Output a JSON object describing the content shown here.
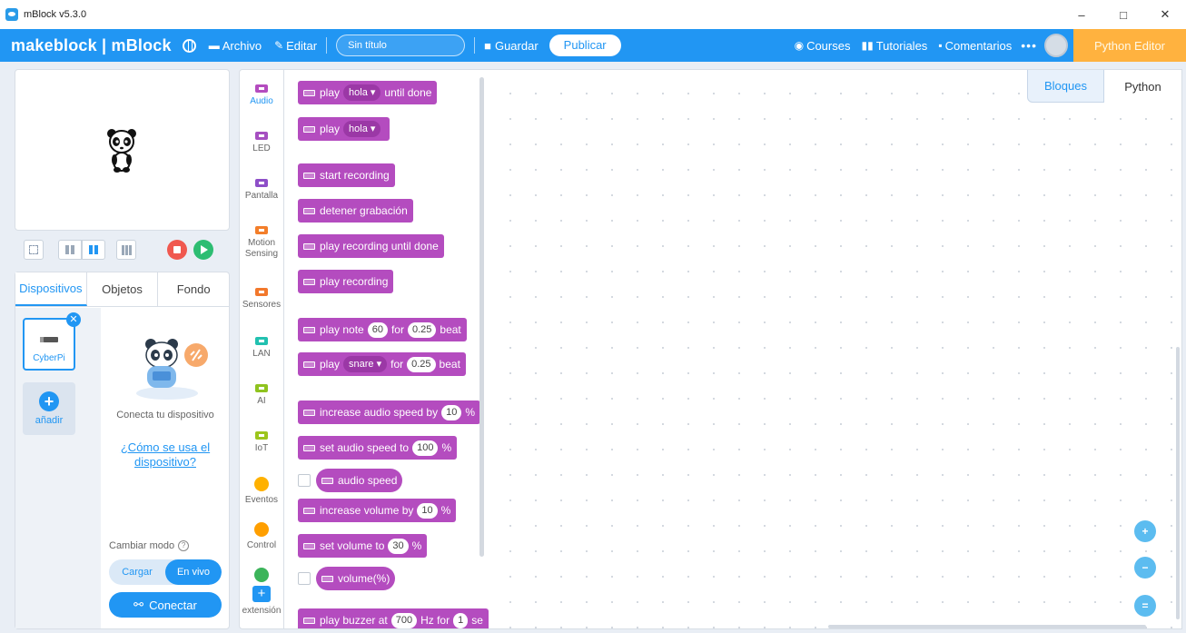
{
  "window": {
    "title": "mBlock v5.3.0",
    "minimize": "–",
    "maximize": "□",
    "close": "✕"
  },
  "menubar": {
    "brand": "makeblock | mBlock",
    "archivo": "Archivo",
    "editar": "Editar",
    "project_name": "Sin título",
    "guardar": "Guardar",
    "publicar": "Publicar",
    "courses": "Courses",
    "tutoriales": "Tutoriales",
    "comentarios": "Comentarios",
    "more": "•••",
    "python_editor": "Python Editor"
  },
  "device_panel": {
    "tabs": [
      "Dispositivos",
      "Objetos",
      "Fondo"
    ],
    "active_tab": "Dispositivos",
    "device_name": "CyberPi",
    "add_label": "añadir",
    "connect_prompt": "Conecta tu dispositivo",
    "how_link": "¿Cómo se usa el dispositivo?",
    "mode_label": "Cambiar modo",
    "mode_help": "?",
    "mode_options": [
      "Cargar",
      "En vivo"
    ],
    "mode_selected": "En vivo",
    "connect_button": "Conectar"
  },
  "categories": [
    {
      "label": "Audio",
      "color": "#b44cbf",
      "shape": "chip"
    },
    {
      "label": "LED",
      "color": "#a64fc1",
      "shape": "chip"
    },
    {
      "label": "Pantalla",
      "color": "#8e4fc8",
      "shape": "chip"
    },
    {
      "label": "Motion Sensing",
      "color": "#f37e2a",
      "shape": "chip"
    },
    {
      "label": "Sensores",
      "color": "#f2782c",
      "shape": "chip"
    },
    {
      "label": "LAN",
      "color": "#22c1b0",
      "shape": "chip"
    },
    {
      "label": "AI",
      "color": "#8fc31f",
      "shape": "chip"
    },
    {
      "label": "IoT",
      "color": "#9cc51c",
      "shape": "chip"
    },
    {
      "label": "Eventos",
      "color": "#ffb100",
      "shape": "dot"
    },
    {
      "label": "Control",
      "color": "#ff9f00",
      "shape": "dot"
    },
    {
      "label": "",
      "color": "#3cb45a",
      "shape": "dot"
    }
  ],
  "active_category": "Audio",
  "extension_label": "extensión",
  "blocks": {
    "b1": {
      "pre": "play",
      "dd": "hola ▾",
      "post": "until done"
    },
    "b2": {
      "pre": "play",
      "dd": "hola ▾"
    },
    "b3": {
      "pre": "start recording"
    },
    "b4": {
      "pre": "detener grabación"
    },
    "b5": {
      "pre": "play recording until done"
    },
    "b6": {
      "pre": "play recording"
    },
    "b7": {
      "pre": "play note",
      "v1": "60",
      "mid": "for",
      "v2": "0.25",
      "post": "beat"
    },
    "b8": {
      "pre": "play",
      "dd": "snare ▾",
      "mid": "for",
      "v2": "0.25",
      "post": "beat"
    },
    "b9": {
      "pre": "increase audio speed by",
      "v1": "10",
      "post": "%"
    },
    "b10": {
      "pre": "set audio speed to",
      "v1": "100",
      "post": "%"
    },
    "b11": {
      "pre": "audio speed"
    },
    "b12": {
      "pre": "increase volume by",
      "v1": "10",
      "post": "%"
    },
    "b13": {
      "pre": "set volume to",
      "v1": "30",
      "post": "%"
    },
    "b14": {
      "pre": "volume(%)"
    },
    "b15": {
      "pre": "play buzzer at",
      "v1": "700",
      "mid": "Hz for",
      "v2": "1",
      "post": "se"
    }
  },
  "workspace": {
    "code_tabs": [
      "Bloques",
      "Python"
    ],
    "active_code_tab": "Bloques",
    "zoom_in": "+",
    "zoom_out": "−",
    "zoom_reset": "="
  },
  "colors": {
    "brand_blue": "#2196f3",
    "python_editor_orange": "#ffb23f",
    "audio_block": "#b44cbf"
  }
}
